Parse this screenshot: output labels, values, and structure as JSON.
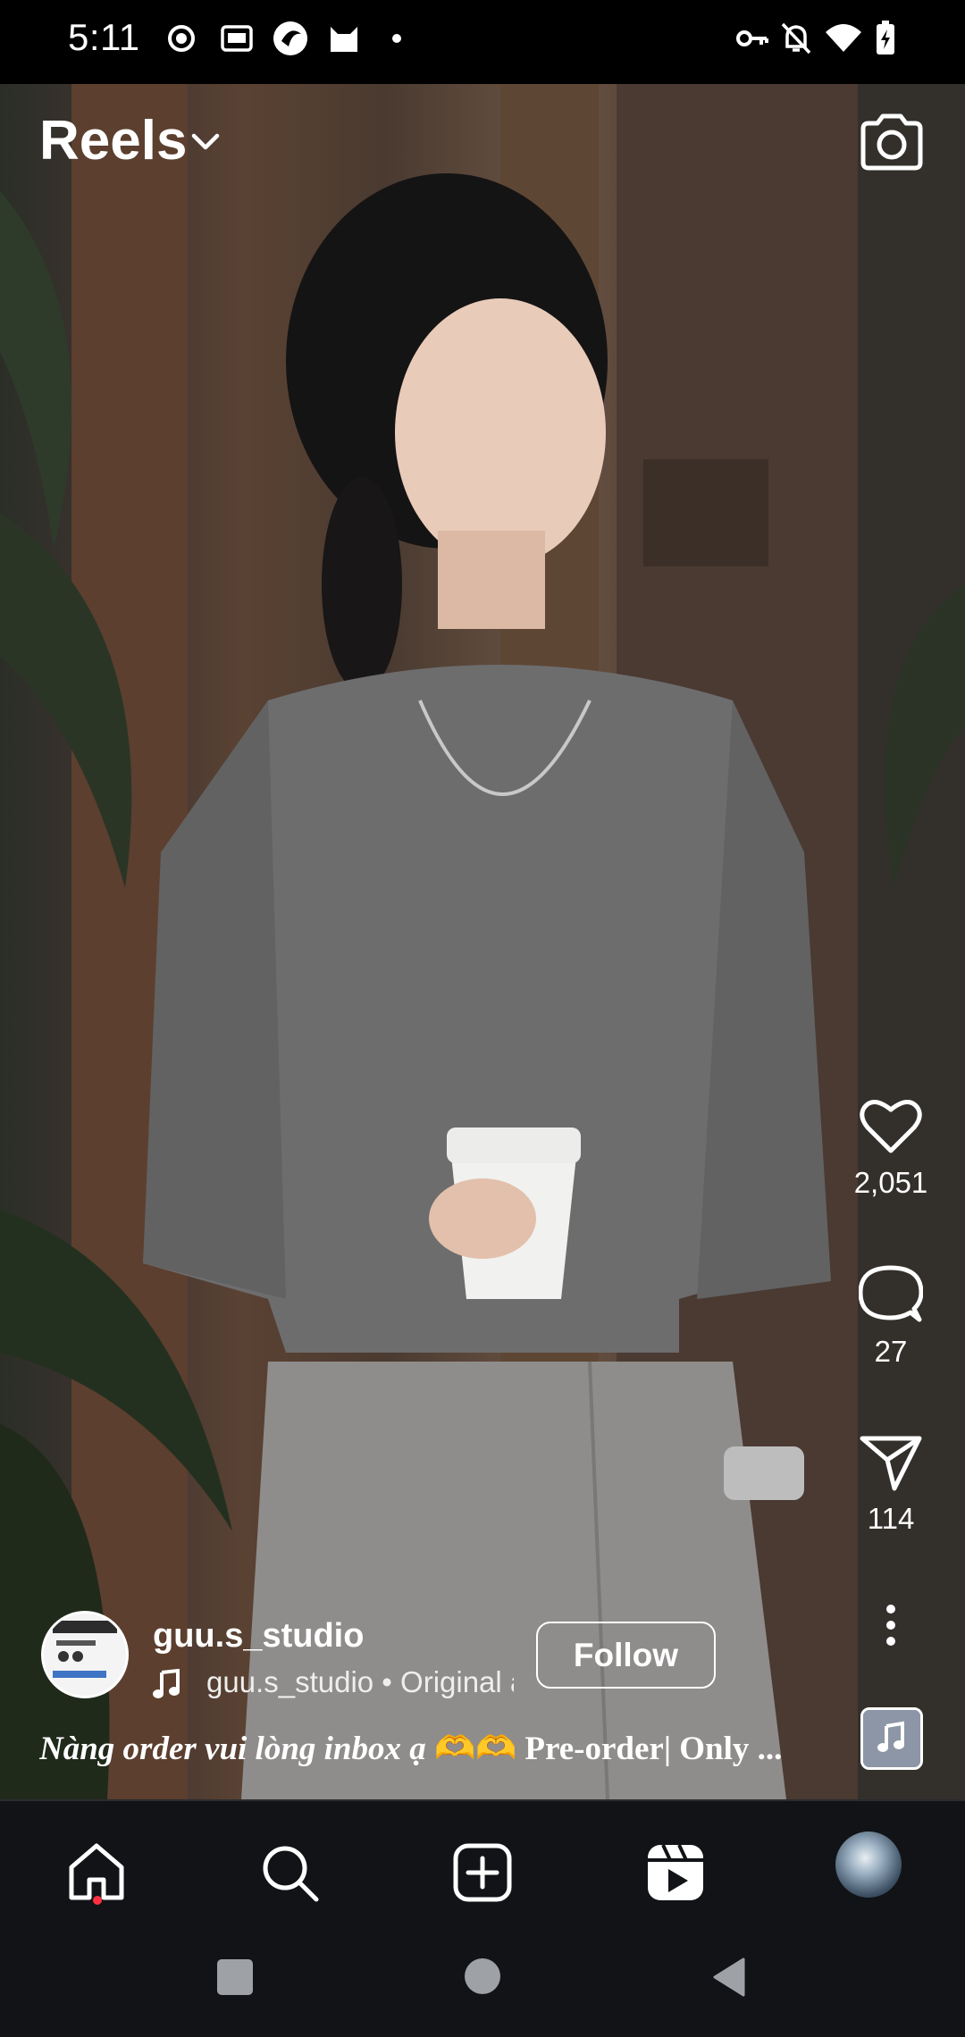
{
  "status_bar": {
    "time": "5:11",
    "icons": [
      "record-icon",
      "iqiyi-icon",
      "app-circle-icon",
      "cat-app-icon",
      "dot-icon",
      "vpn-key-icon",
      "bell-off-icon",
      "wifi-icon",
      "battery-charging-icon"
    ]
  },
  "header": {
    "title": "Reels",
    "dropdown_icon": "chevron-down-icon",
    "camera_icon": "camera-icon"
  },
  "actions": {
    "like_count": "2,051",
    "comment_count": "27",
    "share_count": "114",
    "icons": [
      "heart-icon",
      "comment-icon",
      "send-icon",
      "more-icon"
    ]
  },
  "creator": {
    "username": "guu.s_studio",
    "follow_label": "Follow",
    "audio_text": "guu.s_studio • Original a"
  },
  "caption": {
    "italic_part": "Nàng order vui lòng inbox ạ ",
    "emoji": "🫶🫶",
    "bold_part": " Pre-order| Only ..."
  },
  "nav": {
    "items": [
      "home-icon",
      "search-icon",
      "create-icon",
      "reels-icon",
      "profile-avatar"
    ]
  },
  "colors": {
    "background": "#000000",
    "nav_background": "#111317",
    "notification_dot": "#ff3040",
    "text": "#ffffff"
  }
}
